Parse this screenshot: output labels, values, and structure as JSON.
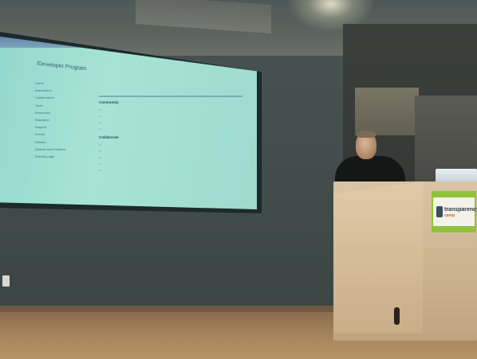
{
  "slide": {
    "title": "/Developer Program",
    "nav": [
      "Home",
      "Instructions",
      "Collaborators",
      "Tools",
      "Resources",
      "Education",
      "Support",
      "Events",
      "Wheels",
      "Wheels and Positions",
      "Edit this page"
    ],
    "section1": "Community",
    "section2": "Collaborate",
    "bullets1": [
      "...",
      "...",
      "...",
      "..."
    ],
    "bullets2": [
      "...",
      "...",
      "...",
      "...",
      "..."
    ]
  },
  "sign": {
    "line1": "transparency",
    "line2": "camp"
  }
}
